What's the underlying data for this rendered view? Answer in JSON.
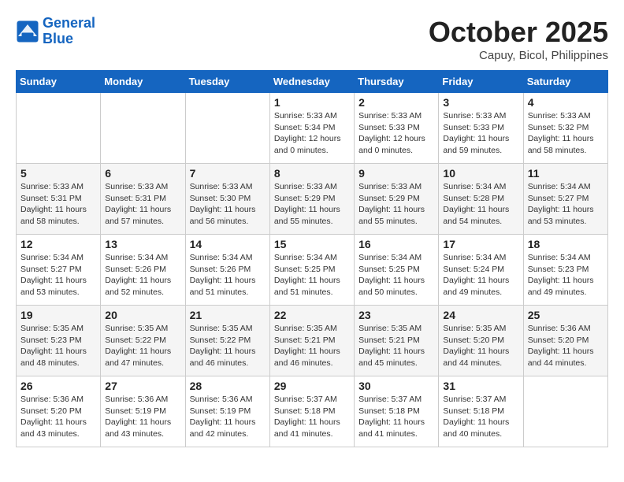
{
  "header": {
    "logo_line1": "General",
    "logo_line2": "Blue",
    "month": "October 2025",
    "location": "Capuy, Bicol, Philippines"
  },
  "weekdays": [
    "Sunday",
    "Monday",
    "Tuesday",
    "Wednesday",
    "Thursday",
    "Friday",
    "Saturday"
  ],
  "weeks": [
    [
      {
        "day": "",
        "sunrise": "",
        "sunset": "",
        "daylight": ""
      },
      {
        "day": "",
        "sunrise": "",
        "sunset": "",
        "daylight": ""
      },
      {
        "day": "",
        "sunrise": "",
        "sunset": "",
        "daylight": ""
      },
      {
        "day": "1",
        "sunrise": "Sunrise: 5:33 AM",
        "sunset": "Sunset: 5:34 PM",
        "daylight": "Daylight: 12 hours and 0 minutes."
      },
      {
        "day": "2",
        "sunrise": "Sunrise: 5:33 AM",
        "sunset": "Sunset: 5:33 PM",
        "daylight": "Daylight: 12 hours and 0 minutes."
      },
      {
        "day": "3",
        "sunrise": "Sunrise: 5:33 AM",
        "sunset": "Sunset: 5:33 PM",
        "daylight": "Daylight: 11 hours and 59 minutes."
      },
      {
        "day": "4",
        "sunrise": "Sunrise: 5:33 AM",
        "sunset": "Sunset: 5:32 PM",
        "daylight": "Daylight: 11 hours and 58 minutes."
      }
    ],
    [
      {
        "day": "5",
        "sunrise": "Sunrise: 5:33 AM",
        "sunset": "Sunset: 5:31 PM",
        "daylight": "Daylight: 11 hours and 58 minutes."
      },
      {
        "day": "6",
        "sunrise": "Sunrise: 5:33 AM",
        "sunset": "Sunset: 5:31 PM",
        "daylight": "Daylight: 11 hours and 57 minutes."
      },
      {
        "day": "7",
        "sunrise": "Sunrise: 5:33 AM",
        "sunset": "Sunset: 5:30 PM",
        "daylight": "Daylight: 11 hours and 56 minutes."
      },
      {
        "day": "8",
        "sunrise": "Sunrise: 5:33 AM",
        "sunset": "Sunset: 5:29 PM",
        "daylight": "Daylight: 11 hours and 55 minutes."
      },
      {
        "day": "9",
        "sunrise": "Sunrise: 5:33 AM",
        "sunset": "Sunset: 5:29 PM",
        "daylight": "Daylight: 11 hours and 55 minutes."
      },
      {
        "day": "10",
        "sunrise": "Sunrise: 5:34 AM",
        "sunset": "Sunset: 5:28 PM",
        "daylight": "Daylight: 11 hours and 54 minutes."
      },
      {
        "day": "11",
        "sunrise": "Sunrise: 5:34 AM",
        "sunset": "Sunset: 5:27 PM",
        "daylight": "Daylight: 11 hours and 53 minutes."
      }
    ],
    [
      {
        "day": "12",
        "sunrise": "Sunrise: 5:34 AM",
        "sunset": "Sunset: 5:27 PM",
        "daylight": "Daylight: 11 hours and 53 minutes."
      },
      {
        "day": "13",
        "sunrise": "Sunrise: 5:34 AM",
        "sunset": "Sunset: 5:26 PM",
        "daylight": "Daylight: 11 hours and 52 minutes."
      },
      {
        "day": "14",
        "sunrise": "Sunrise: 5:34 AM",
        "sunset": "Sunset: 5:26 PM",
        "daylight": "Daylight: 11 hours and 51 minutes."
      },
      {
        "day": "15",
        "sunrise": "Sunrise: 5:34 AM",
        "sunset": "Sunset: 5:25 PM",
        "daylight": "Daylight: 11 hours and 51 minutes."
      },
      {
        "day": "16",
        "sunrise": "Sunrise: 5:34 AM",
        "sunset": "Sunset: 5:25 PM",
        "daylight": "Daylight: 11 hours and 50 minutes."
      },
      {
        "day": "17",
        "sunrise": "Sunrise: 5:34 AM",
        "sunset": "Sunset: 5:24 PM",
        "daylight": "Daylight: 11 hours and 49 minutes."
      },
      {
        "day": "18",
        "sunrise": "Sunrise: 5:34 AM",
        "sunset": "Sunset: 5:23 PM",
        "daylight": "Daylight: 11 hours and 49 minutes."
      }
    ],
    [
      {
        "day": "19",
        "sunrise": "Sunrise: 5:35 AM",
        "sunset": "Sunset: 5:23 PM",
        "daylight": "Daylight: 11 hours and 48 minutes."
      },
      {
        "day": "20",
        "sunrise": "Sunrise: 5:35 AM",
        "sunset": "Sunset: 5:22 PM",
        "daylight": "Daylight: 11 hours and 47 minutes."
      },
      {
        "day": "21",
        "sunrise": "Sunrise: 5:35 AM",
        "sunset": "Sunset: 5:22 PM",
        "daylight": "Daylight: 11 hours and 46 minutes."
      },
      {
        "day": "22",
        "sunrise": "Sunrise: 5:35 AM",
        "sunset": "Sunset: 5:21 PM",
        "daylight": "Daylight: 11 hours and 46 minutes."
      },
      {
        "day": "23",
        "sunrise": "Sunrise: 5:35 AM",
        "sunset": "Sunset: 5:21 PM",
        "daylight": "Daylight: 11 hours and 45 minutes."
      },
      {
        "day": "24",
        "sunrise": "Sunrise: 5:35 AM",
        "sunset": "Sunset: 5:20 PM",
        "daylight": "Daylight: 11 hours and 44 minutes."
      },
      {
        "day": "25",
        "sunrise": "Sunrise: 5:36 AM",
        "sunset": "Sunset: 5:20 PM",
        "daylight": "Daylight: 11 hours and 44 minutes."
      }
    ],
    [
      {
        "day": "26",
        "sunrise": "Sunrise: 5:36 AM",
        "sunset": "Sunset: 5:20 PM",
        "daylight": "Daylight: 11 hours and 43 minutes."
      },
      {
        "day": "27",
        "sunrise": "Sunrise: 5:36 AM",
        "sunset": "Sunset: 5:19 PM",
        "daylight": "Daylight: 11 hours and 43 minutes."
      },
      {
        "day": "28",
        "sunrise": "Sunrise: 5:36 AM",
        "sunset": "Sunset: 5:19 PM",
        "daylight": "Daylight: 11 hours and 42 minutes."
      },
      {
        "day": "29",
        "sunrise": "Sunrise: 5:37 AM",
        "sunset": "Sunset: 5:18 PM",
        "daylight": "Daylight: 11 hours and 41 minutes."
      },
      {
        "day": "30",
        "sunrise": "Sunrise: 5:37 AM",
        "sunset": "Sunset: 5:18 PM",
        "daylight": "Daylight: 11 hours and 41 minutes."
      },
      {
        "day": "31",
        "sunrise": "Sunrise: 5:37 AM",
        "sunset": "Sunset: 5:18 PM",
        "daylight": "Daylight: 11 hours and 40 minutes."
      },
      {
        "day": "",
        "sunrise": "",
        "sunset": "",
        "daylight": ""
      }
    ]
  ]
}
